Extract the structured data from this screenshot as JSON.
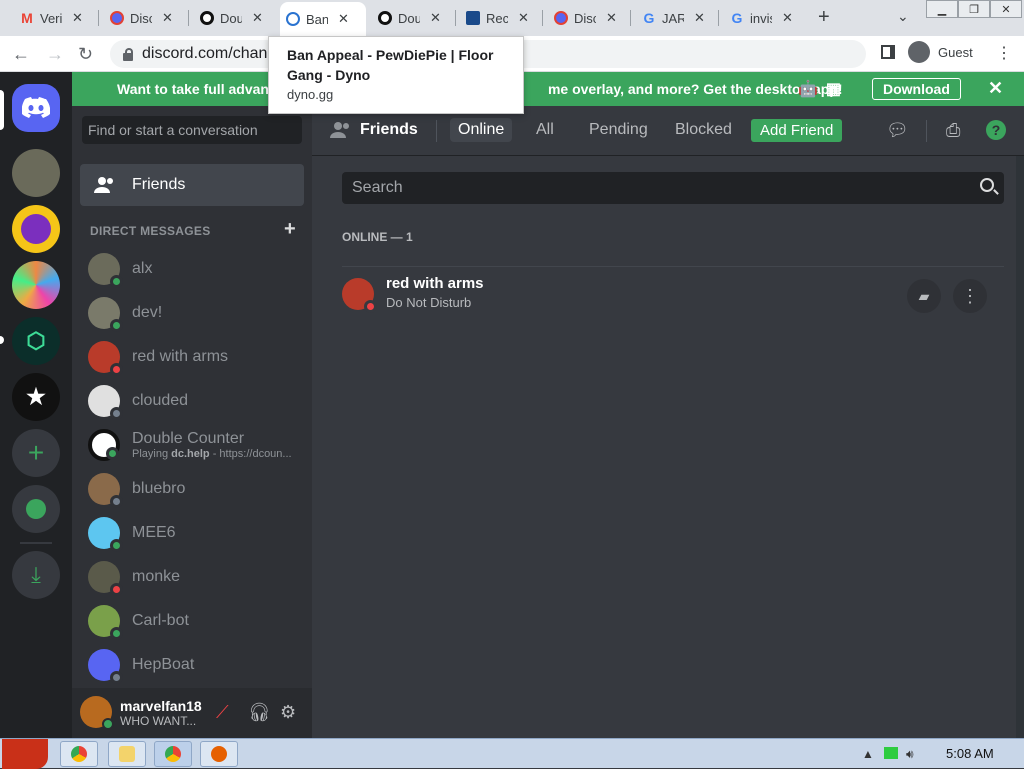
{
  "browser": {
    "tabs": [
      {
        "title": "Verif",
        "favicon": "gmail-icon"
      },
      {
        "title": "Disco",
        "favicon": "discord-icon"
      },
      {
        "title": "Dou",
        "favicon": "double-counter-icon"
      },
      {
        "title": "Ban",
        "favicon": "dyno-icon"
      },
      {
        "title": "Dou",
        "favicon": "double-counter-icon"
      },
      {
        "title": "Reco",
        "favicon": "mail-icon"
      },
      {
        "title": "Disc",
        "favicon": "discord-icon"
      },
      {
        "title": "JAR",
        "favicon": "google-icon"
      },
      {
        "title": "invis",
        "favicon": "google-icon"
      }
    ],
    "url": "discord.com/chann",
    "profile_label": "Guest",
    "tooltip": {
      "title": "Ban Appeal - PewDiePie | Floor Gang - Dyno",
      "domain": "dyno.gg"
    }
  },
  "banner": {
    "message": "Want to take full advantag",
    "message_tail": "me overlay, and more? Get the desktop app!",
    "download_label": "Download"
  },
  "dm": {
    "search_placeholder": "Find or start a conversation",
    "friends_label": "Friends",
    "header": "DIRECT MESSAGES",
    "items": [
      {
        "name": "alx",
        "status": "online",
        "color": "#6b6b5b"
      },
      {
        "name": "dev!",
        "status": "online",
        "color": "#7a7a6a"
      },
      {
        "name": "red with arms",
        "status": "dnd",
        "color": "#b93b2a"
      },
      {
        "name": "clouded",
        "status": "offline",
        "color": "#e0e0e0"
      },
      {
        "name": "Double Counter",
        "sub_prefix": "Playing ",
        "sub_bold": "dc.help",
        "sub_rest": " - https://dcoun...",
        "status": "online",
        "color": "#ffffff"
      },
      {
        "name": "bluebro",
        "status": "offline",
        "color": "#8a6a4a"
      },
      {
        "name": "MEE6",
        "status": "online",
        "color": "#5dc6f0"
      },
      {
        "name": "monke",
        "status": "dnd",
        "color": "#5a5a4a"
      },
      {
        "name": "Carl-bot",
        "status": "online",
        "color": "#7aa04a"
      },
      {
        "name": "HepBoat",
        "status": "offline",
        "color": "#5865f2"
      }
    ]
  },
  "user": {
    "name": "marvelfan18",
    "status": "WHO WANT..."
  },
  "main": {
    "title": "Friends",
    "tabs": [
      "Online",
      "All",
      "Pending",
      "Blocked"
    ],
    "add_friend": "Add Friend",
    "search_placeholder": "Search",
    "online_label": "ONLINE — 1",
    "friend": {
      "name": "red with arms",
      "status": "Do Not Disturb"
    }
  },
  "taskbar": {
    "time": "5:08 AM"
  },
  "colors": {
    "accent": "#5865f2",
    "green": "#3ba55d",
    "dnd": "#ed4245",
    "offline": "#747f8d"
  }
}
